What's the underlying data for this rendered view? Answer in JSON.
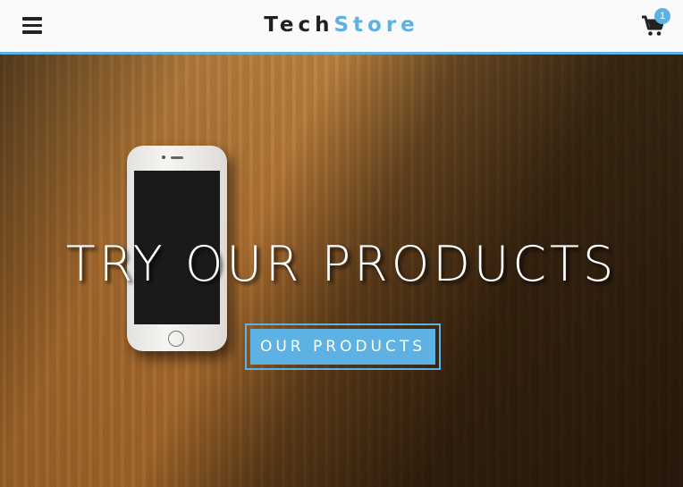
{
  "header": {
    "brand_part1": "Tech",
    "brand_part2": "Store",
    "cart_count": "1",
    "menu_icon": "hamburger-menu-icon",
    "cart_icon": "shopping-cart-icon"
  },
  "hero": {
    "title": "TRY OUR PRODUCTS",
    "cta_label": "OUR PRODUCTS",
    "image_subject": "smartphone on wooden table"
  },
  "colors": {
    "accent": "#5db2e3",
    "brand_dark": "#1f1f1f",
    "header_bg": "#fafafa"
  }
}
